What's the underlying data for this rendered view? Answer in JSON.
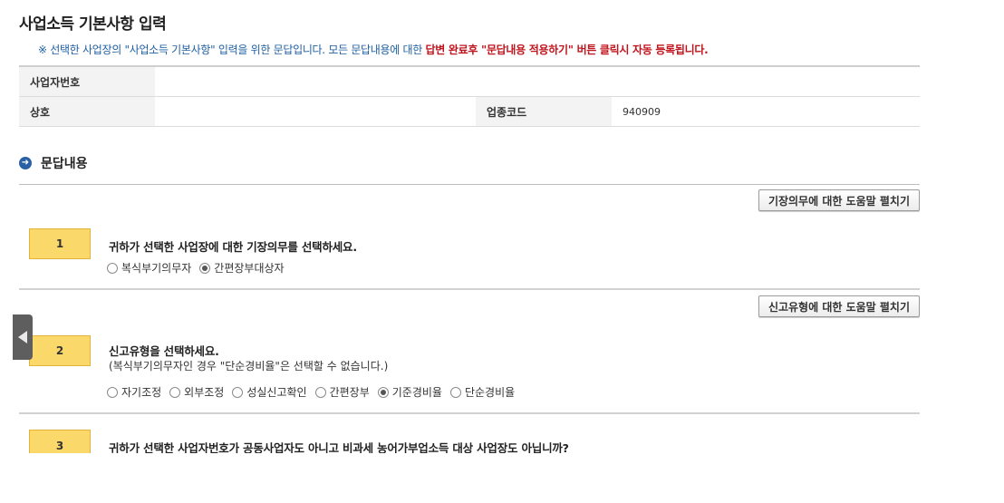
{
  "page": {
    "title": "사업소득 기본사항 입력",
    "notice_prefix": "※ 선택한 사업장의 \"사업소득 기본사항\" 입력을 위한 문답입니다. 모든 문답내용에 대한 ",
    "notice_strong": "답변 완료후 \"문답내용 적용하기\" 버튼 클릭시 자동 등록됩니다."
  },
  "info": {
    "business_no_label": "사업자번호",
    "business_no_value": "",
    "company_label": "상호",
    "company_value": "",
    "industry_code_label": "업종코드",
    "industry_code_value": "940909"
  },
  "section": {
    "title": "문답내용"
  },
  "questions": [
    {
      "number": "1",
      "help_button": "기장의무에 대한 도움말 펼치기",
      "text": "귀하가 선택한 사업장에 대한 기장의무를 선택하세요.",
      "sub": "",
      "options": [
        "복식부기의무자",
        "간편장부대상자"
      ],
      "selected": "간편장부대상자"
    },
    {
      "number": "2",
      "help_button": "신고유형에 대한 도움말 펼치기",
      "text": "신고유형을 선택하세요.",
      "sub": "(복식부기의무자인 경우 \"단순경비율\"은 선택할 수 없습니다.)",
      "options": [
        "자기조정",
        "외부조정",
        "성실신고확인",
        "간편장부",
        "기준경비율",
        "단순경비율"
      ],
      "selected": "기준경비율"
    },
    {
      "number": "3",
      "text": "귀하가 선택한 사업자번호가 공동사업자도 아니고 비과세 농어가부업소득 대상 사업장도 아닙니까?"
    }
  ],
  "colors": {
    "accent_blue": "#2b5fa6",
    "notice_red": "#c0141d",
    "qnum_yellow": "#fbd86a"
  }
}
